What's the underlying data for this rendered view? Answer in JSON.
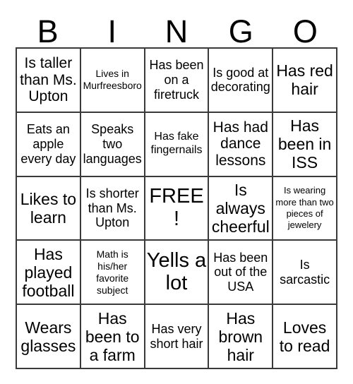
{
  "header": {
    "letters": [
      "B",
      "I",
      "N",
      "G",
      "O"
    ]
  },
  "grid": {
    "columns": 5,
    "rows": 5,
    "free_space_index": 12,
    "border_color": "#3a3a3a",
    "cell_background": "#ffffff",
    "text_color": "#000000",
    "cells": [
      {
        "text": "Is taller than Ms. Upton",
        "size": "fs-lg"
      },
      {
        "text": "Lives in Murfreesboro",
        "size": "fs-xs"
      },
      {
        "text": "Has been on a firetruck",
        "size": "fs-md"
      },
      {
        "text": "Is good at decorating",
        "size": "fs-md"
      },
      {
        "text": "Has red hair",
        "size": "fs-xl"
      },
      {
        "text": "Eats an apple every day",
        "size": "fs-md"
      },
      {
        "text": "Speaks two languages",
        "size": "fs-md"
      },
      {
        "text": "Has fake fingernails",
        "size": "fs-sm"
      },
      {
        "text": "Has had dance lessons",
        "size": "fs-lg"
      },
      {
        "text": "Has been in ISS",
        "size": "fs-xl"
      },
      {
        "text": "Likes to learn",
        "size": "fs-xl"
      },
      {
        "text": "Is shorter than Ms. Upton",
        "size": "fs-md"
      },
      {
        "text": "FREE!",
        "size": "fs-xxl"
      },
      {
        "text": "Is always cheerful",
        "size": "fs-xl"
      },
      {
        "text": "Is wearing more than two pieces of jewelery",
        "size": "fs-xxs"
      },
      {
        "text": "Has played football",
        "size": "fs-xl"
      },
      {
        "text": "Math is his/her favorite subject",
        "size": "fs-xs"
      },
      {
        "text": "Yells a lot",
        "size": "fs-xxl"
      },
      {
        "text": "Has been out of the USA",
        "size": "fs-md"
      },
      {
        "text": "Is sarcastic",
        "size": "fs-md"
      },
      {
        "text": "Wears glasses",
        "size": "fs-xl"
      },
      {
        "text": "Has been to a farm",
        "size": "fs-xl"
      },
      {
        "text": "Has very short hair",
        "size": "fs-md"
      },
      {
        "text": "Has brown hair",
        "size": "fs-xl"
      },
      {
        "text": "Loves to read",
        "size": "fs-xl"
      }
    ]
  }
}
